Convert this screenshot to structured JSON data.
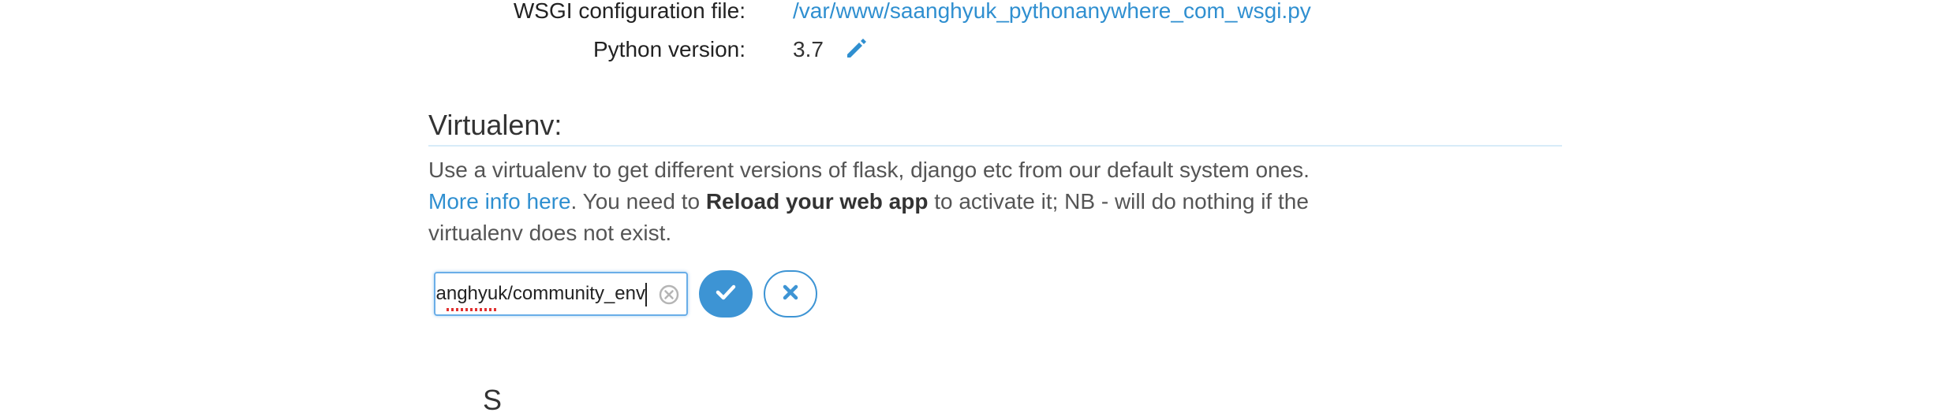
{
  "code_info": {
    "wsgi_label": "WSGI configuration file:",
    "wsgi_value": "/var/www/saanghyuk_pythonanywhere_com_wsgi.py",
    "python_label": "Python version:",
    "python_value": "3.7",
    "edit_icon": "pencil-icon"
  },
  "virtualenv": {
    "title": "Virtualenv:",
    "desc_part1": "Use a virtualenv to get different versions of flask, django etc from our default system ones. ",
    "more_info_link": "More info here",
    "desc_part2": ". You need to ",
    "reload_bold": "Reload your web app",
    "desc_part3": " to activate it; NB - will do nothing if the virtualenv does not exist.",
    "input_value": "anghyuk/community_env",
    "clear_icon": "clear-circle-icon",
    "confirm_icon": "check-icon",
    "cancel_icon": "close-icon"
  },
  "colors": {
    "link": "#2f8fd0",
    "accent": "#3d94d4"
  }
}
